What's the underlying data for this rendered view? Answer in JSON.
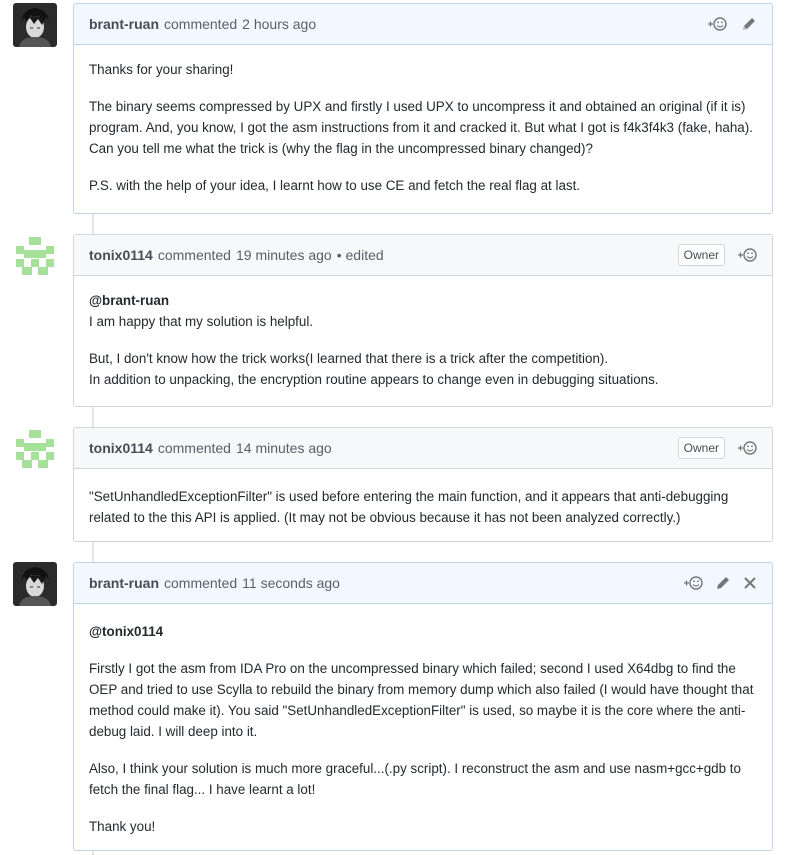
{
  "comments": [
    {
      "author": "brant-ruan",
      "action": "commented",
      "time": "2 hours ago",
      "paragraphs": [
        "Thanks for your sharing!",
        "The binary seems compressed by UPX and firstly I used UPX to uncompress it and obtained an original (if it is) program. And, you know, I got the asm instructions from it and cracked it. But what I got is f4k3f4k3 (fake, haha). Can you tell me what the trick is (why the flag in the uncompressed binary changed)?",
        "P.S. with the help of your idea, I learnt how to use CE and fetch the real flag at last."
      ]
    },
    {
      "author": "tonix0114",
      "action": "commented",
      "time": "19 minutes ago",
      "edited": "• edited",
      "badge": "Owner",
      "mention": "@brant-ruan",
      "paragraphs": [
        "I am happy that my solution is helpful.",
        "But, I don't know how the trick works(I learned that there is a trick after the competition).",
        "In addition to unpacking, the encryption routine appears to change even in debugging situations."
      ]
    },
    {
      "author": "tonix0114",
      "action": "commented",
      "time": "14 minutes ago",
      "badge": "Owner",
      "paragraphs": [
        "\"SetUnhandledExceptionFilter\" is used before entering the main function, and it appears that anti-debugging related to the this API is applied. (It may not be obvious because it has not been analyzed correctly.)"
      ]
    },
    {
      "author": "brant-ruan",
      "action": "commented",
      "time": "11 seconds ago",
      "mention": "@tonix0114",
      "paragraphs": [
        "Firstly I got the asm from IDA Pro on the uncompressed binary which failed; second I used X64dbg to find the OEP and tried to use Scylla to rebuild the binary from memory dump which also failed (I would have thought that method could make it). You said \"SetUnhandledExceptionFilter\" is used, so maybe it is the core where the anti-debug laid. I will deep into it.",
        "Also, I think your solution is much more graceful...(.py script). I reconstruct the asm and use nasm+gcc+gdb to fetch the final flag... I have learnt a lot!",
        "Thank you!"
      ]
    }
  ],
  "icons": {
    "reaction": "add-reaction-icon",
    "edit": "pencil-icon",
    "delete": "close-icon",
    "avatar_brant": "dark-portrait-avatar",
    "avatar_tonix": "green-identicon-avatar"
  },
  "colors": {
    "own_header_bg": "#f1f8ff",
    "own_border": "#c0d3eb",
    "header_bg": "#f6f8fa",
    "border": "#d1d5da",
    "identicon": "#a6e19a"
  }
}
